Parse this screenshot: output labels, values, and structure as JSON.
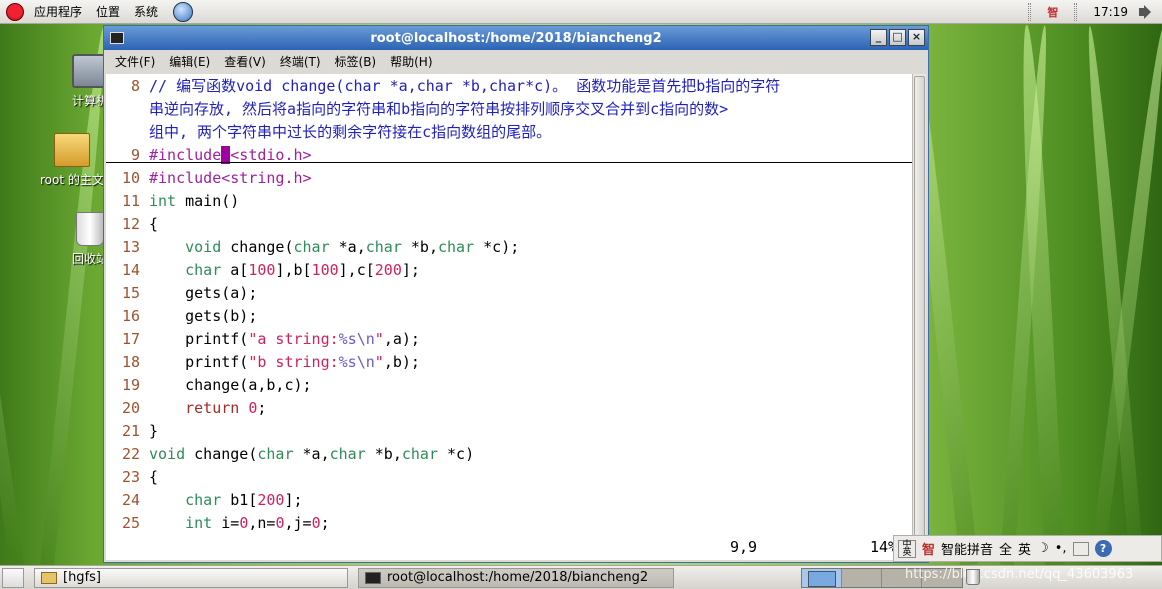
{
  "top_panel": {
    "menus": [
      "应用程序",
      "位置",
      "系统"
    ],
    "clock": "17:19",
    "ime_indicator": "智"
  },
  "desktop_icons": [
    {
      "label": "计算机",
      "icon": "computer-icon"
    },
    {
      "label": "root 的主文件夹",
      "icon": "home-folder-icon"
    },
    {
      "label": "回收站",
      "icon": "trash-icon"
    }
  ],
  "window": {
    "title": "root@localhost:/home/2018/biancheng2",
    "menus": [
      "文件(F)",
      "编辑(E)",
      "查看(V)",
      "终端(T)",
      "标签(B)",
      "帮助(H)"
    ]
  },
  "editor": {
    "comment_line_no": "8",
    "comment_lines": [
      "// 编写函数void change(char *a,char *b,char*c)。 函数功能是首先把b指向的字符",
      "串逆向存放, 然后将a指向的字符串和b指向的字符串按排列顺序交叉合并到c指向的数>",
      "组中, 两个字符串中过长的剩余字符接在c指向数组的尾部。"
    ],
    "line9": {
      "no": "9",
      "pre": "#include",
      "cursor": "<",
      "post": "<stdio.h>"
    },
    "line10": {
      "no": "10",
      "text": "#include<string.h>"
    },
    "line11": {
      "no": "11",
      "kw": "int",
      "rest": " main()"
    },
    "line12": {
      "no": "12",
      "text": "{"
    },
    "line13": {
      "no": "13",
      "a": "    void",
      "b": " change(",
      "c": "char",
      "d": " *a,",
      "e": "char",
      "f": " *b,",
      "g": "char",
      "h": " *c);"
    },
    "line14": {
      "no": "14",
      "a": "    char",
      "b": " a[",
      "c": "100",
      "d": "],b[",
      "e": "100",
      "f": "],c[",
      "g": "200",
      "h": "];"
    },
    "line15": {
      "no": "15",
      "text": "    gets(a);"
    },
    "line16": {
      "no": "16",
      "text": "    gets(b);"
    },
    "line17": {
      "no": "17",
      "a": "    printf(",
      "b": "\"a string:",
      "c": "%s\\n",
      "d": "\"",
      "e": ",a);"
    },
    "line18": {
      "no": "18",
      "a": "    printf(",
      "b": "\"b string:",
      "c": "%s\\n",
      "d": "\"",
      "e": ",b);"
    },
    "line19": {
      "no": "19",
      "text": "    change(a,b,c);"
    },
    "line20": {
      "no": "20",
      "a": "    return",
      "b": " 0",
      "c": ";"
    },
    "line21": {
      "no": "21",
      "text": "}"
    },
    "line22": {
      "no": "22",
      "a": "void",
      "b": " change(",
      "c": "char",
      "d": " *a,",
      "e": "char",
      "f": " *b,",
      "g": "char",
      "h": " *c)"
    },
    "line23": {
      "no": "23",
      "text": "{"
    },
    "line24": {
      "no": "24",
      "a": "    char",
      "b": " b1[",
      "c": "200",
      "d": "];"
    },
    "line25": {
      "no": "25",
      "a": "    int",
      "b": " i=",
      "c": "0",
      "d": ",n=",
      "e": "0",
      "f": ",j=",
      "g": "0",
      "h": ";"
    },
    "status_pos": "9,9",
    "status_pct": "14%"
  },
  "ime_bar": {
    "mode": "中英",
    "name": "智能拼音",
    "full": "全",
    "eng": "英",
    "moon": "☽",
    "punct": "•,",
    "help": "?"
  },
  "taskbar": {
    "tasks": [
      "[hgfs]",
      "root@localhost:/home/2018/biancheng2"
    ],
    "watermark": "https://blog.csdn.net/qq_43603963"
  }
}
